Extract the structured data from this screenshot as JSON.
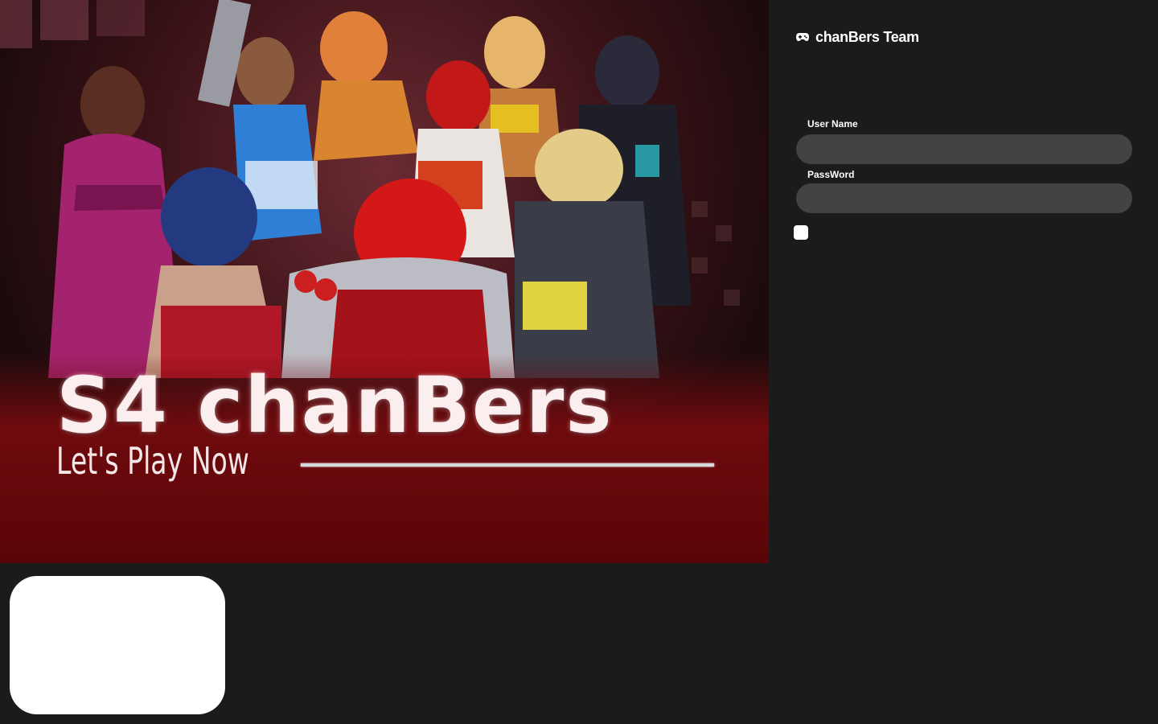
{
  "brand": {
    "icon": "gamepad-icon",
    "name": "chanBers Team"
  },
  "banner": {
    "title": "S4 chanBers",
    "tagline": "Let's Play Now"
  },
  "login": {
    "username_label": "User Name",
    "username_value": "",
    "password_label": "PassWord",
    "password_value": ""
  },
  "colors": {
    "background": "#1b1b1b",
    "input_background": "#434343",
    "banner_red": "#6e0a0d",
    "text": "#ffffff"
  }
}
